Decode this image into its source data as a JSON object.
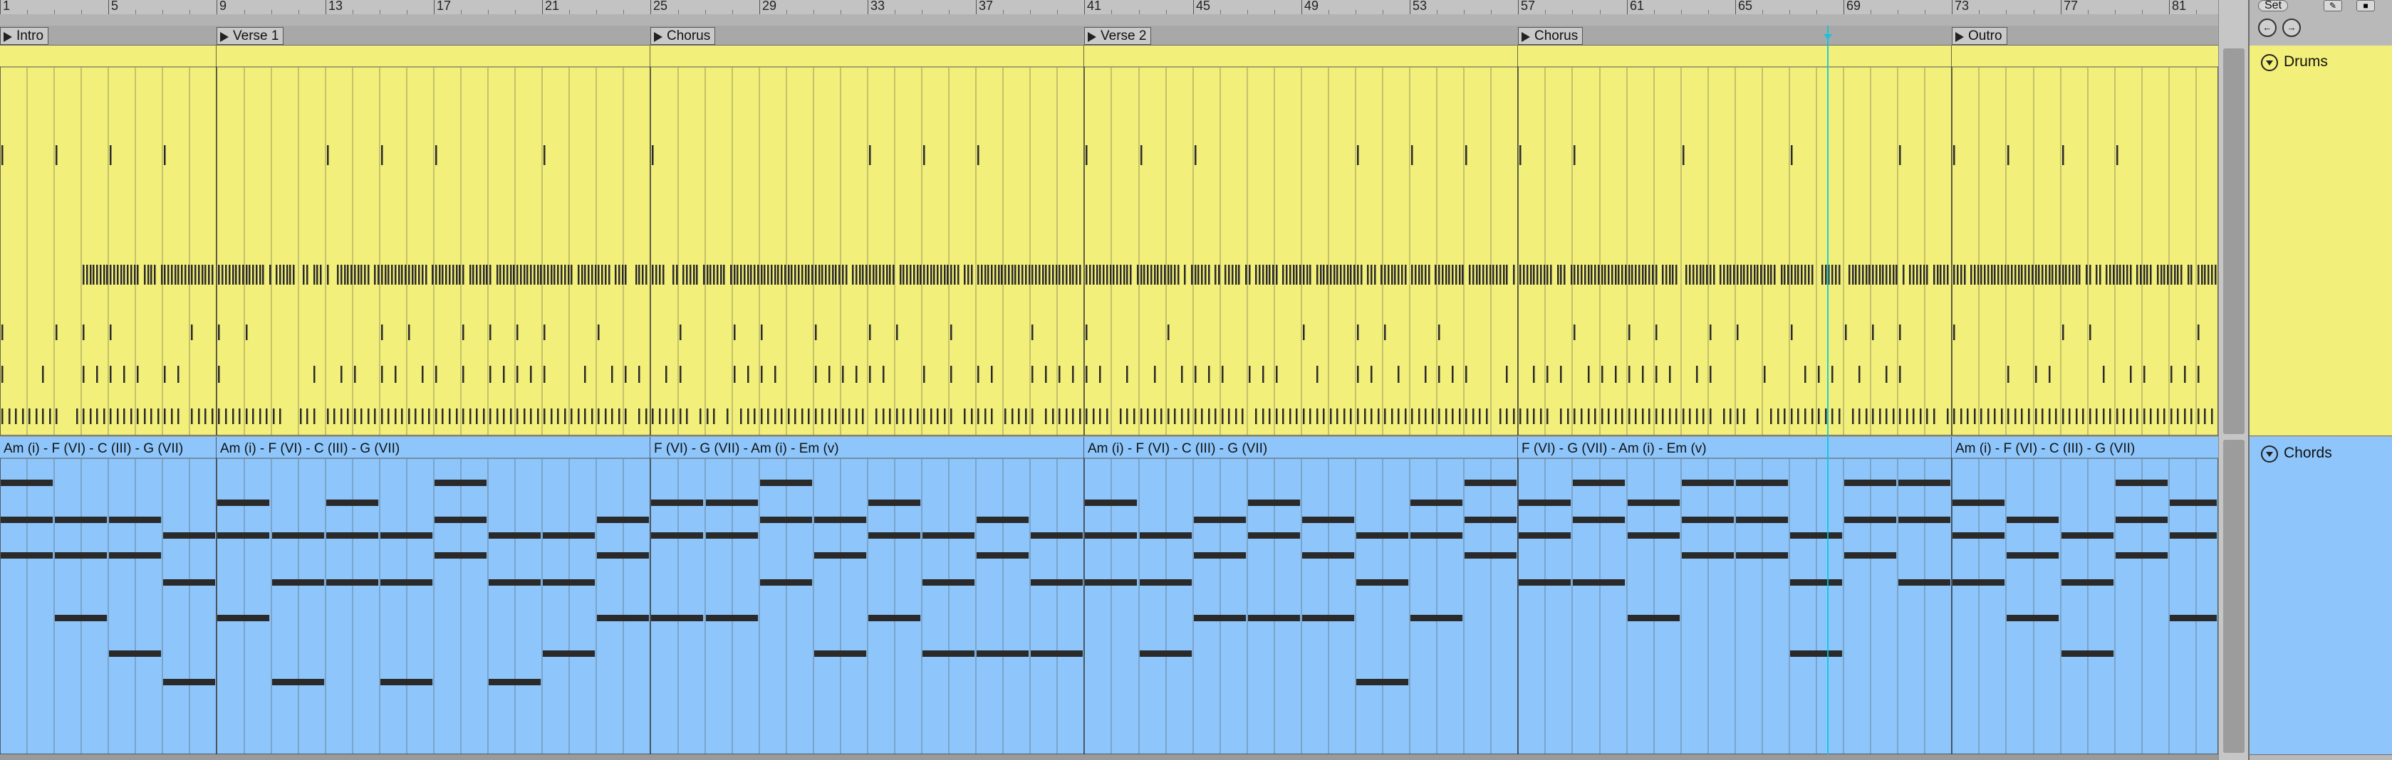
{
  "ruler": {
    "bars": [
      "1",
      "5",
      "9",
      "13",
      "17",
      "21",
      "25",
      "29",
      "33",
      "37",
      "41",
      "45",
      "49",
      "53",
      "57",
      "61",
      "65",
      "69",
      "73",
      "77",
      "81"
    ]
  },
  "locators": [
    {
      "bar": 1,
      "label": "Intro"
    },
    {
      "bar": 9,
      "label": "Verse 1"
    },
    {
      "bar": 25,
      "label": "Chorus"
    },
    {
      "bar": 41,
      "label": "Verse 2"
    },
    {
      "bar": 57,
      "label": "Chorus"
    },
    {
      "bar": 73,
      "label": "Outro"
    }
  ],
  "tracks": [
    {
      "name": "Drums",
      "color": "#f2ef7a",
      "clips": [
        {
          "start": 1,
          "end": 9,
          "label": ""
        },
        {
          "start": 9,
          "end": 25,
          "label": ""
        },
        {
          "start": 25,
          "end": 41,
          "label": ""
        },
        {
          "start": 41,
          "end": 57,
          "label": ""
        },
        {
          "start": 57,
          "end": 73,
          "label": ""
        },
        {
          "start": 73,
          "end": 83,
          "label": ""
        }
      ]
    },
    {
      "name": "Chords",
      "color": "#8ec6fb",
      "clips": [
        {
          "start": 1,
          "end": 9,
          "label": "Am (i) - F (VI) - C (III) - G (VII)"
        },
        {
          "start": 9,
          "end": 25,
          "label": "Am (i) - F (VI) - C (III) - G (VII)"
        },
        {
          "start": 25,
          "end": 41,
          "label": "F (VI) - G (VII) - Am (i) - Em (v)"
        },
        {
          "start": 41,
          "end": 57,
          "label": "Am (i) - F (VI) - C (III) - G (VII)"
        },
        {
          "start": 57,
          "end": 73,
          "label": "F (VI) - G (VII) - Am (i) - Em (v)"
        },
        {
          "start": 73,
          "end": 83,
          "label": "Am (i) - F (VI) - C (III) - G (VII)"
        }
      ]
    }
  ],
  "playhead_bar": 68.4,
  "accent_color": "#00c8e0",
  "note_color": "#2a2a2a",
  "controls": {
    "set_label": "Set",
    "nav_back_icon": "left-arrow-circle-icon",
    "nav_forward_icon": "right-arrow-circle-icon",
    "draw_mode_icon": "pencil-icon",
    "lock_icon": "lock-icon"
  }
}
